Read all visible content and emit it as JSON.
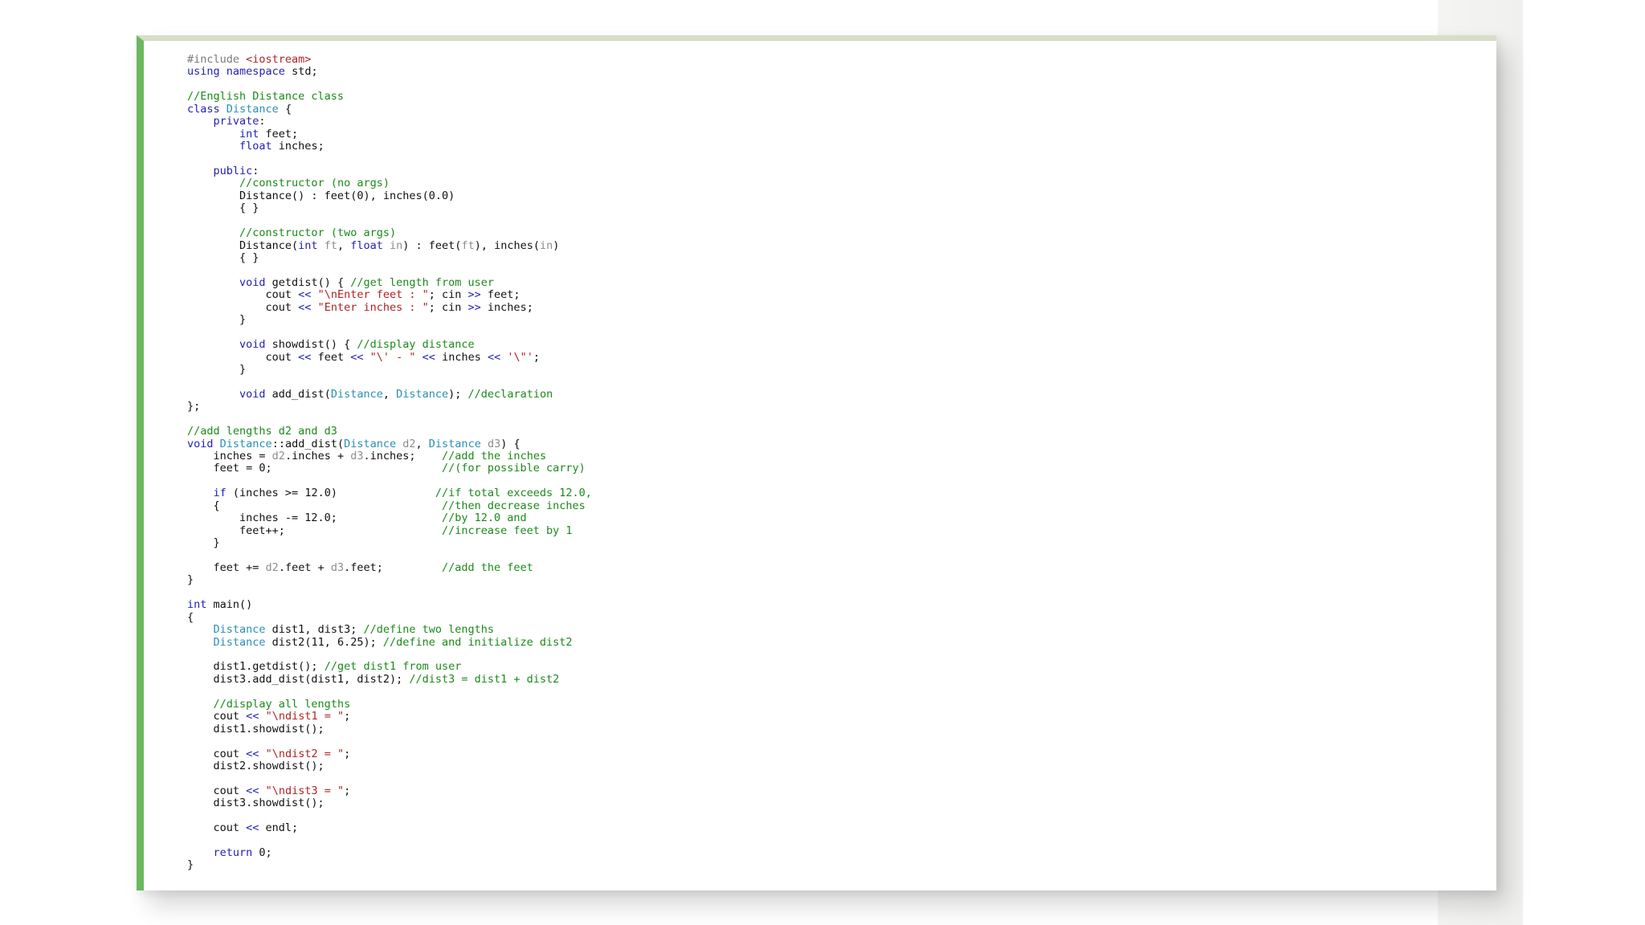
{
  "colors": {
    "accent_bar": "#6cb85f",
    "top_border": "#d6dec8",
    "keyword": "#1f1fb8",
    "type": "#2b8fb3",
    "comment": "#1a8a1a",
    "string": "#b22222",
    "preprocessor": "#7a7a7a",
    "parameter": "#8d8d8d"
  },
  "code": {
    "language": "C++",
    "lines": [
      [
        [
          "pre",
          "#include "
        ],
        [
          "str",
          "<iostream>"
        ]
      ],
      [
        [
          "kw",
          "using"
        ],
        [
          "plain",
          " "
        ],
        [
          "kw",
          "namespace"
        ],
        [
          "plain",
          " std;"
        ]
      ],
      [],
      [
        [
          "com",
          "//English Distance class"
        ]
      ],
      [
        [
          "kw",
          "class"
        ],
        [
          "plain",
          " "
        ],
        [
          "type",
          "Distance"
        ],
        [
          "plain",
          " {"
        ]
      ],
      [
        [
          "plain",
          "    "
        ],
        [
          "kw",
          "private"
        ],
        [
          "plain",
          ":"
        ]
      ],
      [
        [
          "plain",
          "        "
        ],
        [
          "kw",
          "int"
        ],
        [
          "plain",
          " feet;"
        ]
      ],
      [
        [
          "plain",
          "        "
        ],
        [
          "kw",
          "float"
        ],
        [
          "plain",
          " inches;"
        ]
      ],
      [],
      [
        [
          "plain",
          "    "
        ],
        [
          "kw",
          "public"
        ],
        [
          "plain",
          ":"
        ]
      ],
      [
        [
          "plain",
          "        "
        ],
        [
          "com",
          "//constructor (no args)"
        ]
      ],
      [
        [
          "plain",
          "        Distance() : feet(0), inches(0.0)"
        ]
      ],
      [
        [
          "plain",
          "        { }"
        ]
      ],
      [],
      [
        [
          "plain",
          "        "
        ],
        [
          "com",
          "//constructor (two args)"
        ]
      ],
      [
        [
          "plain",
          "        Distance("
        ],
        [
          "kw",
          "int"
        ],
        [
          "plain",
          " "
        ],
        [
          "param",
          "ft"
        ],
        [
          "plain",
          ", "
        ],
        [
          "kw",
          "float"
        ],
        [
          "plain",
          " "
        ],
        [
          "param",
          "in"
        ],
        [
          "plain",
          ") : feet("
        ],
        [
          "param",
          "ft"
        ],
        [
          "plain",
          "), inches("
        ],
        [
          "param",
          "in"
        ],
        [
          "plain",
          ")"
        ]
      ],
      [
        [
          "plain",
          "        { }"
        ]
      ],
      [],
      [
        [
          "plain",
          "        "
        ],
        [
          "kw",
          "void"
        ],
        [
          "plain",
          " getdist() { "
        ],
        [
          "com",
          "//get length from user"
        ]
      ],
      [
        [
          "plain",
          "            cout "
        ],
        [
          "op",
          "<<"
        ],
        [
          "plain",
          " "
        ],
        [
          "str",
          "\"\\nEnter feet : \""
        ],
        [
          "plain",
          "; cin "
        ],
        [
          "op",
          ">>"
        ],
        [
          "plain",
          " feet;"
        ]
      ],
      [
        [
          "plain",
          "            cout "
        ],
        [
          "op",
          "<<"
        ],
        [
          "plain",
          " "
        ],
        [
          "str",
          "\"Enter inches : \""
        ],
        [
          "plain",
          "; cin "
        ],
        [
          "op",
          ">>"
        ],
        [
          "plain",
          " inches;"
        ]
      ],
      [
        [
          "plain",
          "        }"
        ]
      ],
      [],
      [
        [
          "plain",
          "        "
        ],
        [
          "kw",
          "void"
        ],
        [
          "plain",
          " showdist() { "
        ],
        [
          "com",
          "//display distance"
        ]
      ],
      [
        [
          "plain",
          "            cout "
        ],
        [
          "op",
          "<<"
        ],
        [
          "plain",
          " feet "
        ],
        [
          "op",
          "<<"
        ],
        [
          "plain",
          " "
        ],
        [
          "str",
          "\"\\' - \""
        ],
        [
          "plain",
          " "
        ],
        [
          "op",
          "<<"
        ],
        [
          "plain",
          " inches "
        ],
        [
          "op",
          "<<"
        ],
        [
          "plain",
          " "
        ],
        [
          "str",
          "'\\\"'"
        ],
        [
          "plain",
          ";"
        ]
      ],
      [
        [
          "plain",
          "        }"
        ]
      ],
      [],
      [
        [
          "plain",
          "        "
        ],
        [
          "kw",
          "void"
        ],
        [
          "plain",
          " add_dist("
        ],
        [
          "type",
          "Distance"
        ],
        [
          "plain",
          ", "
        ],
        [
          "type",
          "Distance"
        ],
        [
          "plain",
          "); "
        ],
        [
          "com",
          "//declaration"
        ]
      ],
      [
        [
          "plain",
          "};"
        ]
      ],
      [],
      [
        [
          "com",
          "//add lengths d2 and d3"
        ]
      ],
      [
        [
          "kw",
          "void"
        ],
        [
          "plain",
          " "
        ],
        [
          "type",
          "Distance"
        ],
        [
          "plain",
          "::add_dist("
        ],
        [
          "type",
          "Distance"
        ],
        [
          "plain",
          " "
        ],
        [
          "param",
          "d2"
        ],
        [
          "plain",
          ", "
        ],
        [
          "type",
          "Distance"
        ],
        [
          "plain",
          " "
        ],
        [
          "param",
          "d3"
        ],
        [
          "plain",
          ") {"
        ]
      ],
      [
        [
          "plain",
          "    inches = "
        ],
        [
          "param",
          "d2"
        ],
        [
          "plain",
          ".inches + "
        ],
        [
          "param",
          "d3"
        ],
        [
          "plain",
          ".inches;    "
        ],
        [
          "com",
          "//add the inches"
        ]
      ],
      [
        [
          "plain",
          "    feet = 0;                          "
        ],
        [
          "com",
          "//(for possible carry)"
        ]
      ],
      [],
      [
        [
          "plain",
          "    "
        ],
        [
          "kw",
          "if"
        ],
        [
          "plain",
          " (inches >= 12.0)               "
        ],
        [
          "com",
          "//if total exceeds 12.0,"
        ]
      ],
      [
        [
          "plain",
          "    {                                  "
        ],
        [
          "com",
          "//then decrease inches"
        ]
      ],
      [
        [
          "plain",
          "        inches -= 12.0;                "
        ],
        [
          "com",
          "//by 12.0 and"
        ]
      ],
      [
        [
          "plain",
          "        feet++;                        "
        ],
        [
          "com",
          "//increase feet by 1"
        ]
      ],
      [
        [
          "plain",
          "    }"
        ]
      ],
      [],
      [
        [
          "plain",
          "    feet += "
        ],
        [
          "param",
          "d2"
        ],
        [
          "plain",
          ".feet + "
        ],
        [
          "param",
          "d3"
        ],
        [
          "plain",
          ".feet;         "
        ],
        [
          "com",
          "//add the feet"
        ]
      ],
      [
        [
          "plain",
          "}"
        ]
      ],
      [],
      [
        [
          "kw",
          "int"
        ],
        [
          "plain",
          " main()"
        ]
      ],
      [
        [
          "plain",
          "{"
        ]
      ],
      [
        [
          "plain",
          "    "
        ],
        [
          "type",
          "Distance"
        ],
        [
          "plain",
          " dist1, dist3; "
        ],
        [
          "com",
          "//define two lengths"
        ]
      ],
      [
        [
          "plain",
          "    "
        ],
        [
          "type",
          "Distance"
        ],
        [
          "plain",
          " dist2(11, 6.25); "
        ],
        [
          "com",
          "//define and initialize dist2"
        ]
      ],
      [],
      [
        [
          "plain",
          "    dist1.getdist(); "
        ],
        [
          "com",
          "//get dist1 from user"
        ]
      ],
      [
        [
          "plain",
          "    dist3.add_dist(dist1, dist2); "
        ],
        [
          "com",
          "//dist3 = dist1 + dist2"
        ]
      ],
      [],
      [
        [
          "plain",
          "    "
        ],
        [
          "com",
          "//display all lengths"
        ]
      ],
      [
        [
          "plain",
          "    cout "
        ],
        [
          "op",
          "<<"
        ],
        [
          "plain",
          " "
        ],
        [
          "str",
          "\"\\ndist1 = \""
        ],
        [
          "plain",
          ";"
        ]
      ],
      [
        [
          "plain",
          "    dist1.showdist();"
        ]
      ],
      [],
      [
        [
          "plain",
          "    cout "
        ],
        [
          "op",
          "<<"
        ],
        [
          "plain",
          " "
        ],
        [
          "str",
          "\"\\ndist2 = \""
        ],
        [
          "plain",
          ";"
        ]
      ],
      [
        [
          "plain",
          "    dist2.showdist();"
        ]
      ],
      [],
      [
        [
          "plain",
          "    cout "
        ],
        [
          "op",
          "<<"
        ],
        [
          "plain",
          " "
        ],
        [
          "str",
          "\"\\ndist3 = \""
        ],
        [
          "plain",
          ";"
        ]
      ],
      [
        [
          "plain",
          "    dist3.showdist();"
        ]
      ],
      [],
      [
        [
          "plain",
          "    cout "
        ],
        [
          "op",
          "<<"
        ],
        [
          "plain",
          " endl;"
        ]
      ],
      [],
      [
        [
          "plain",
          "    "
        ],
        [
          "kw",
          "return"
        ],
        [
          "plain",
          " 0;"
        ]
      ],
      [
        [
          "plain",
          "}"
        ]
      ]
    ]
  }
}
